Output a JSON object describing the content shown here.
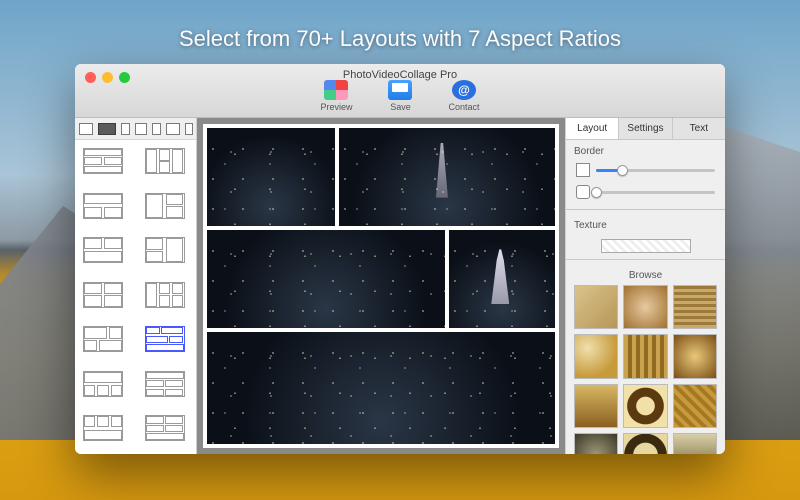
{
  "headline": "Select from 70+ Layouts with 7 Aspect Ratios",
  "window": {
    "title": "PhotoVideoCollage Pro",
    "toolbar": {
      "preview": "Preview",
      "save": "Save",
      "contact": "Contact"
    }
  },
  "sidebar": {
    "aspect_ratios": [
      {
        "w": 14,
        "h": 12,
        "selected": false
      },
      {
        "w": 18,
        "h": 12,
        "selected": true
      },
      {
        "w": 9,
        "h": 12,
        "selected": false
      },
      {
        "w": 12,
        "h": 12,
        "selected": false
      },
      {
        "w": 9,
        "h": 12,
        "selected": false
      },
      {
        "w": 14,
        "h": 12,
        "selected": false
      },
      {
        "w": 8,
        "h": 12,
        "selected": false
      }
    ],
    "layouts": [
      {
        "pattern": "3row-split",
        "selected": false
      },
      {
        "pattern": "3col-split",
        "selected": false
      },
      {
        "pattern": "wide-over-two",
        "selected": false
      },
      {
        "pattern": "col-then-two",
        "selected": false
      },
      {
        "pattern": "two-over-wide",
        "selected": false
      },
      {
        "pattern": "two-then-col",
        "selected": false
      },
      {
        "pattern": "2x2",
        "selected": false
      },
      {
        "pattern": "col-2x2",
        "selected": false
      },
      {
        "pattern": "2x2-offset",
        "selected": false
      },
      {
        "pattern": "brick-5",
        "selected": true
      },
      {
        "pattern": "wide-over-3",
        "selected": false
      },
      {
        "pattern": "row-2x2",
        "selected": false
      },
      {
        "pattern": "3-over-wide",
        "selected": false
      },
      {
        "pattern": "2x2-over-row",
        "selected": false
      }
    ]
  },
  "panel": {
    "tabs": [
      {
        "label": "Layout",
        "active": true
      },
      {
        "label": "Settings",
        "active": false
      },
      {
        "label": "Text",
        "active": false
      }
    ],
    "border_label": "Border",
    "slider1": 22,
    "slider2": 0,
    "texture_label": "Texture",
    "browse_label": "Browse",
    "textures": [
      "linear-gradient(135deg,#d9c38a,#b89659)",
      "radial-gradient(circle,#e6caa0,#a07030)",
      "repeating-linear-gradient(0deg,#c7a96b 0 3px,#9d7a3a 3px 6px)",
      "radial-gradient(circle at 30% 30%,#f0dfae,#c79a3a 70%)",
      "repeating-linear-gradient(90deg,#caa24e 0 4px,#8f6a20 4px 8px)",
      "radial-gradient(circle,#e8c878,#7a4e16)",
      "linear-gradient(#d8b864,#8a5f20)",
      "radial-gradient(circle,#f1e0a8 30%,#5c3a10 32% 60%,#f1e0a8 62%)",
      "repeating-linear-gradient(45deg,#c79a40 0 4px,#a67820 4px 8px)",
      "radial-gradient(circle,#a09a7a,#3a3828)",
      "radial-gradient(circle,#e7d8a0 40%,#3a2a10 42% 70%,#e7d8a0 72%)",
      "linear-gradient(#d8cfa8,#6b5a30)"
    ]
  }
}
